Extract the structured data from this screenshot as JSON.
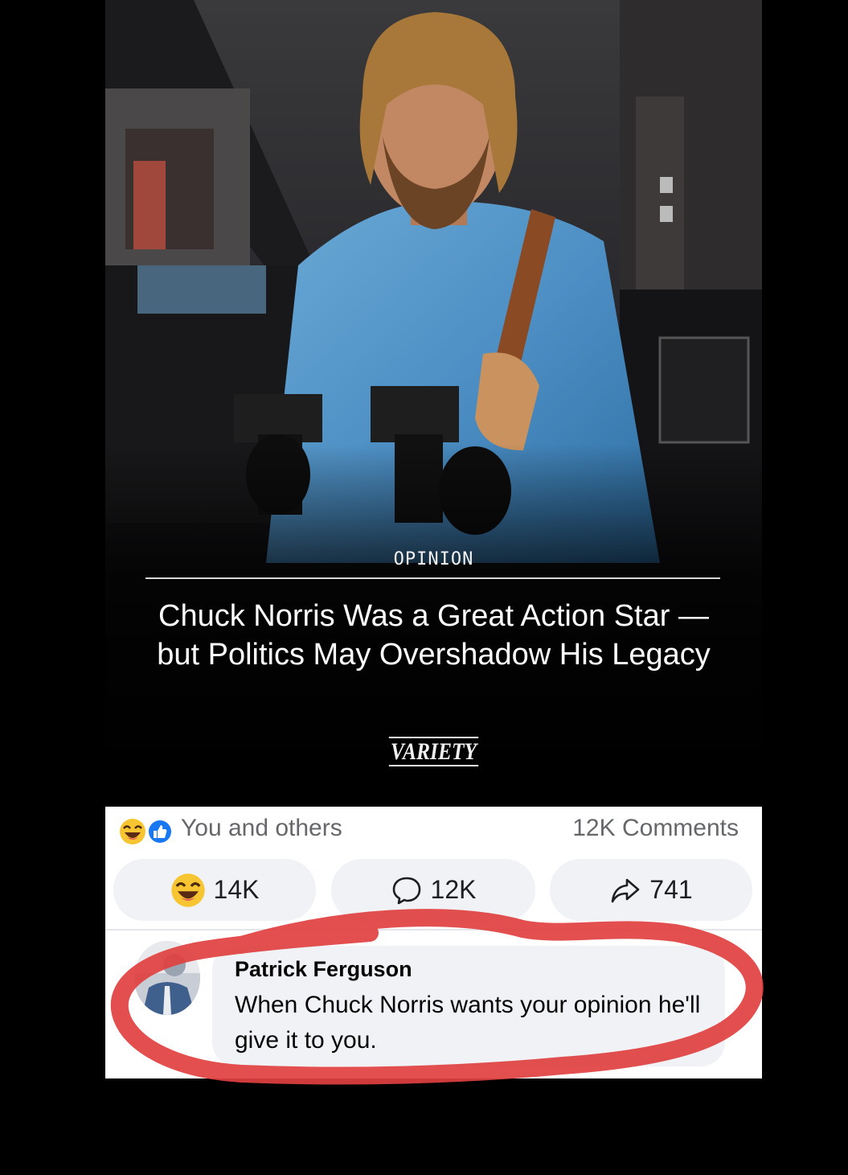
{
  "article": {
    "label": "OPINION",
    "headline": "Chuck Norris Was a Great Action Star — but Politics May Overshadow His Legacy",
    "brand": "VARIETY",
    "photo_description_icon": "photo-of-man-with-two-guns"
  },
  "post_stats": {
    "reaction_icons": [
      "haha-icon",
      "like-icon"
    ],
    "reactors_text": "You and others",
    "comments_text": "12K Comments"
  },
  "actions": {
    "reaction_count": "14K",
    "comment_count": "12K",
    "share_count": "741"
  },
  "comment": {
    "author": "Patrick Ferguson",
    "text": "When Chuck Norris wants your opinion he'll give it to you."
  },
  "colors": {
    "panel_bg": "#ffffff",
    "pill_bg": "#f0f2f5",
    "muted_text": "#65676b",
    "like_blue": "#1877f2",
    "haha_yellow": "#f7c531",
    "annotation_red": "#e0403f"
  }
}
